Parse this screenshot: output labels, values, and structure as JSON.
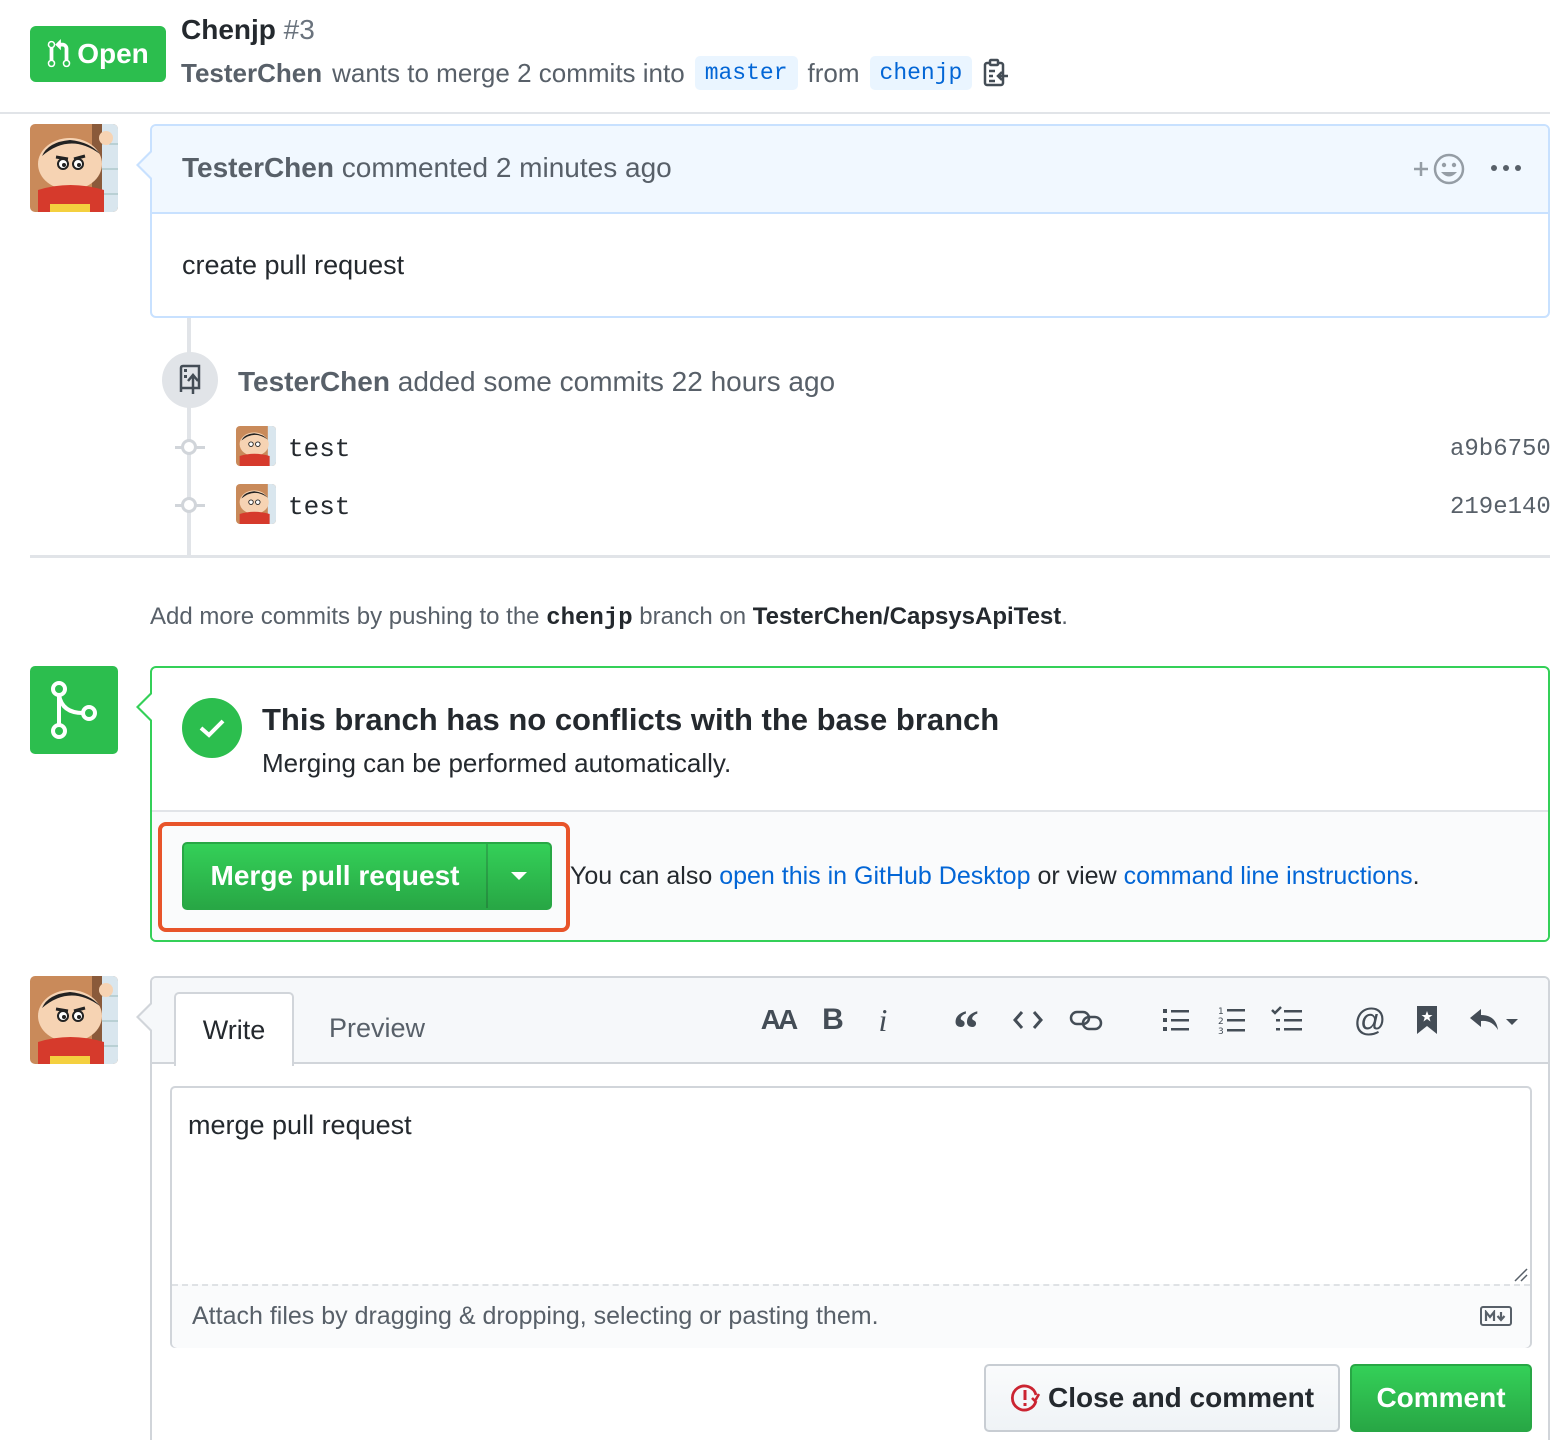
{
  "header": {
    "state": "Open",
    "title": "Chenjp",
    "number": "#3",
    "author": "TesterChen",
    "merge_text": "wants to merge 2 commits into",
    "base_branch": "master",
    "from_text": "from",
    "head_branch": "chenjp"
  },
  "comment": {
    "author": "TesterChen",
    "action": "commented 2 minutes ago",
    "body": "create pull request"
  },
  "timeline": {
    "author": "TesterChen",
    "event": "added some commits 22 hours ago",
    "commits": [
      {
        "message": "test",
        "sha": "a9b6750"
      },
      {
        "message": "test",
        "sha": "219e140"
      }
    ]
  },
  "push_hint": {
    "prefix": "Add more commits by pushing to the",
    "branch": "chenjp",
    "middle": "branch on",
    "repo": "TesterChen/CapsysApiTest",
    "suffix": "."
  },
  "merge": {
    "title": "This branch has no conflicts with the base branch",
    "subtitle": "Merging can be performed automatically.",
    "button": "Merge pull request",
    "alt_prefix": "You can also",
    "alt_link1": "open this in GitHub Desktop",
    "alt_middle": "or view",
    "alt_link2": "command line instructions",
    "alt_suffix": "."
  },
  "form": {
    "tab_write": "Write",
    "tab_preview": "Preview",
    "toolbar": [
      "text-size-icon",
      "bold-icon",
      "italic-icon",
      "quote-icon",
      "code-icon",
      "link-icon",
      "bullet-list-icon",
      "numbered-list-icon",
      "task-list-icon",
      "mention-icon",
      "bookmark-icon",
      "reply-icon"
    ],
    "bold_glyph": "B",
    "italic_glyph": "i",
    "mention_glyph": "@",
    "quote_glyph": "“",
    "text_size_glyph": "AA",
    "textarea_value": "merge pull request",
    "attach_text": "Attach files by dragging & dropping, selecting or pasting them.",
    "close_button": "Close and comment",
    "comment_button": "Comment"
  },
  "colors": {
    "green": "#2cbe4e",
    "link_blue": "#0366d6",
    "highlight": "#e8542a"
  }
}
